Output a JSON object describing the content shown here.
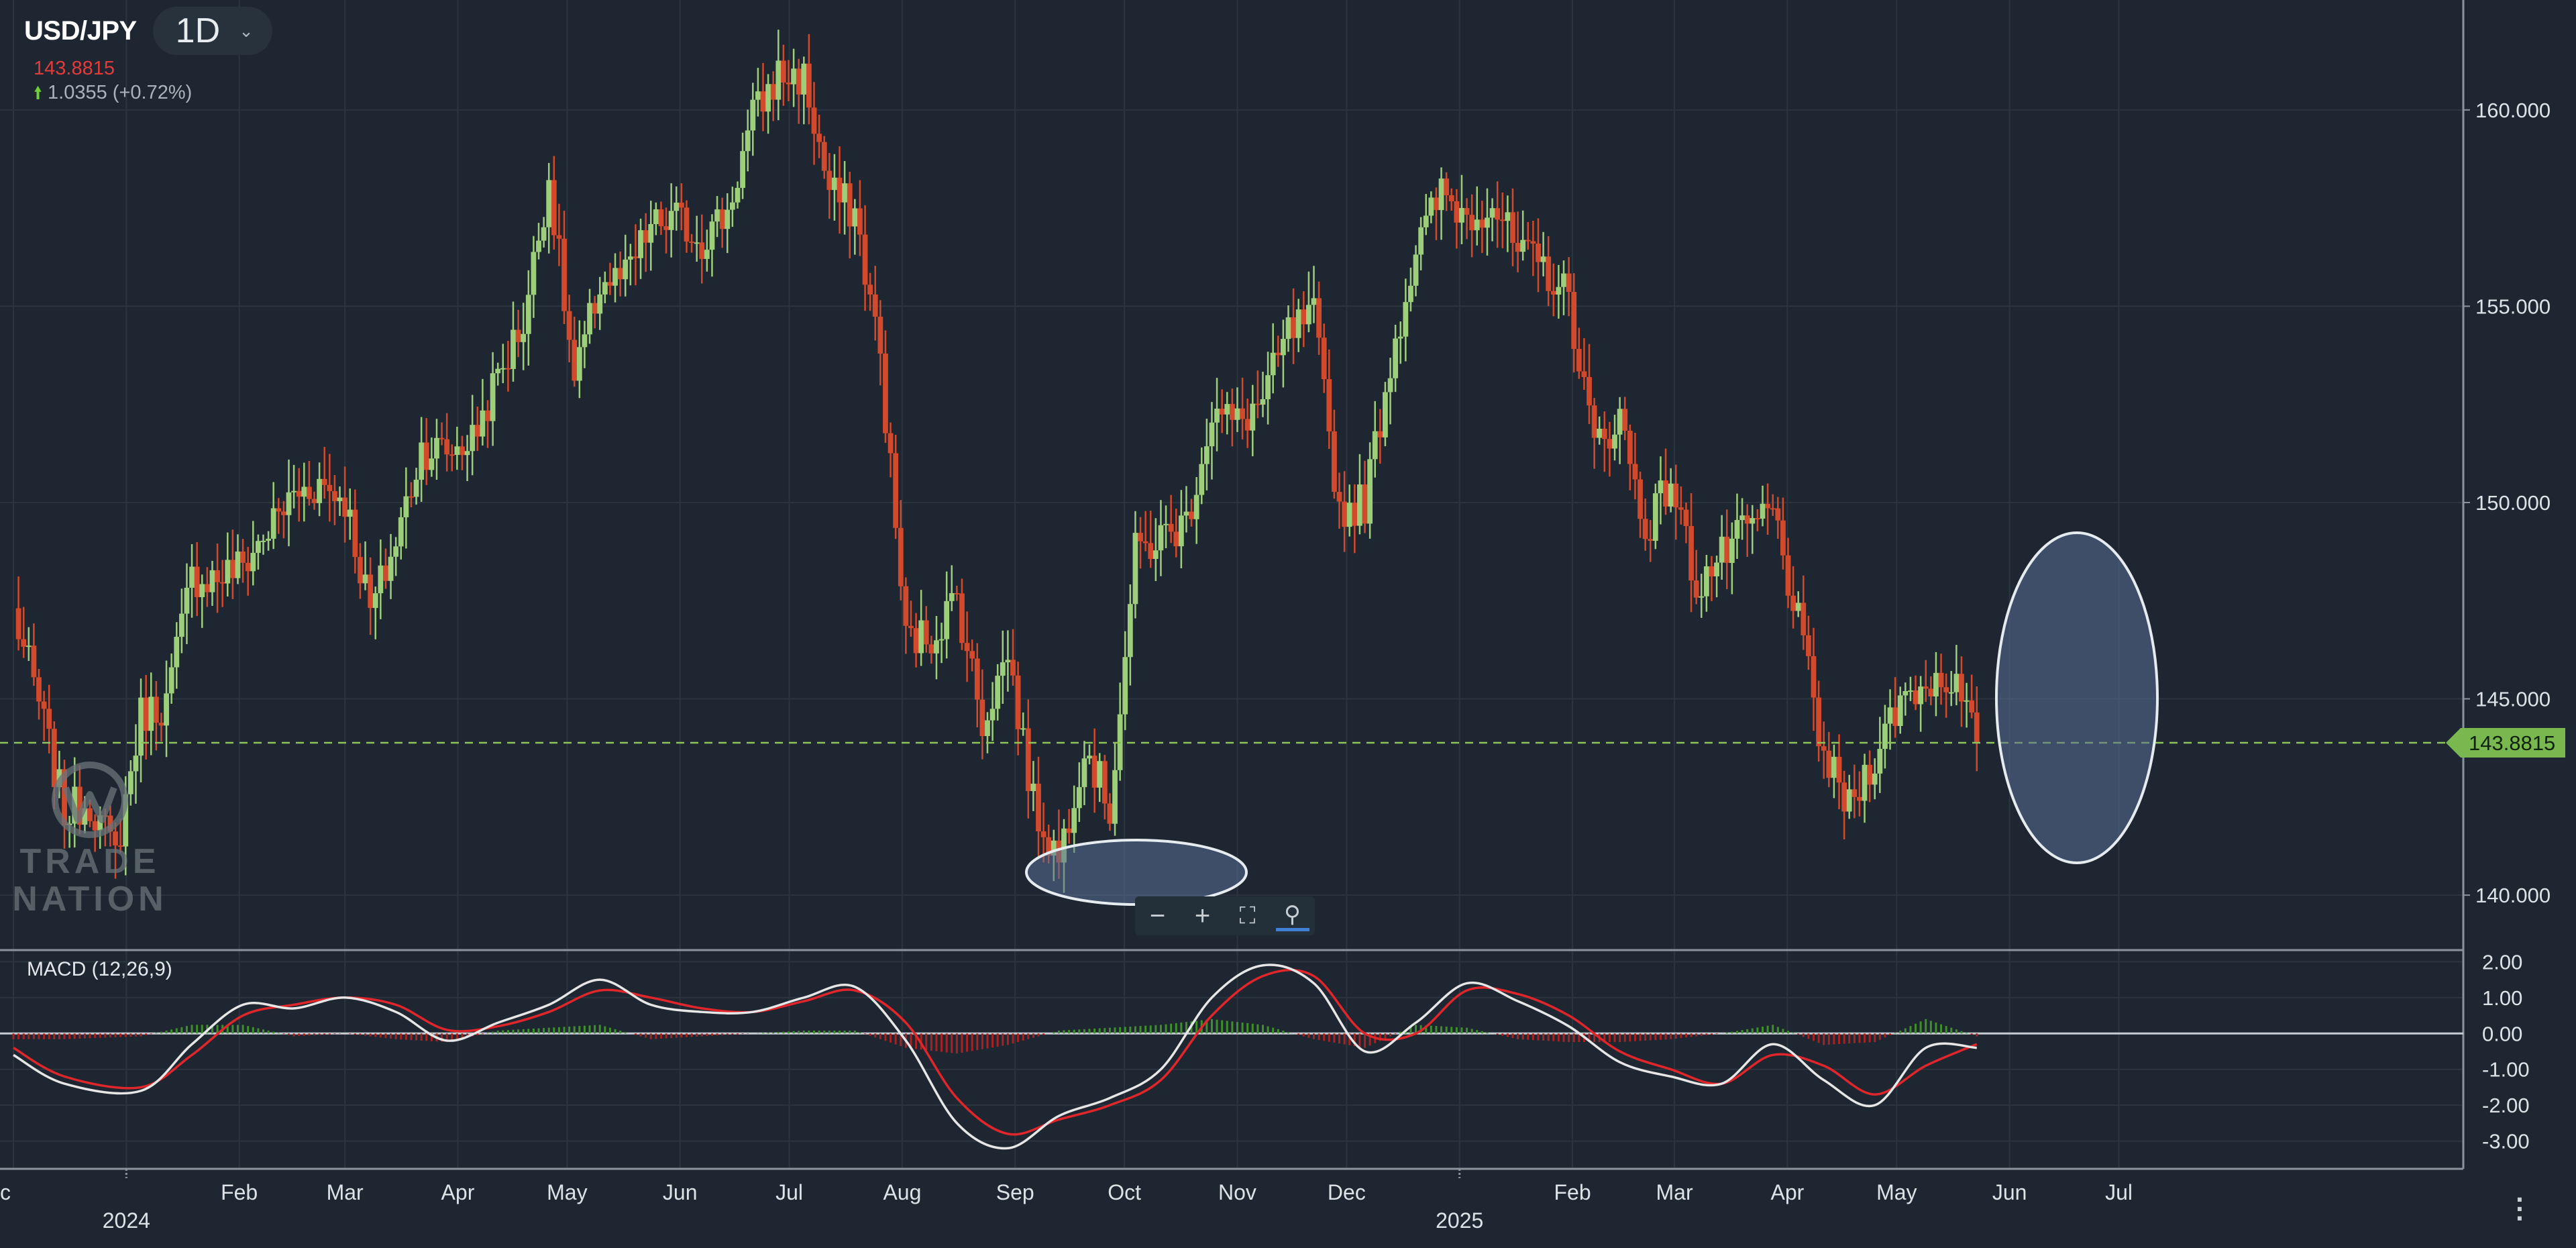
{
  "header": {
    "symbol": "USD/JPY",
    "timeframe": "1D",
    "last_price": "143.8815",
    "change": "1.0355 (+0.72%)"
  },
  "price_tag": "143.8815",
  "macd_label": "MACD (12,26,9)",
  "watermark": {
    "line1": "TRADE",
    "line2": "NATION"
  },
  "colors": {
    "background": "#1e2731",
    "up_candle": "#9dcf7b",
    "down_candle": "#d2492b",
    "macd_line": "#e6e6e6",
    "signal_line": "#e0262a",
    "price_line": "#8fc25a",
    "highlight_ellipse": "#5a6f95"
  },
  "icons": [
    "chevron-down-icon",
    "arrow-up-icon",
    "zoom-out-icon",
    "zoom-in-icon",
    "fullscreen-icon",
    "magnifier-icon",
    "more-vertical-icon"
  ],
  "chart_data": [
    {
      "type": "candlestick",
      "title": "USD/JPY",
      "price_axis": {
        "ticks": [
          140,
          145,
          150,
          155,
          160
        ],
        "tick_labels": [
          "140.000",
          "145.000",
          "150.000",
          "155.000",
          "160.000"
        ],
        "range": [
          138.6,
          162.8
        ]
      },
      "time_axis": {
        "labels": [
          "c",
          "Feb",
          "Mar",
          "Apr",
          "May",
          "Jun",
          "Jul",
          "Aug",
          "Sep",
          "Oct",
          "Nov",
          "Dec",
          "Feb",
          "Mar",
          "Apr",
          "May",
          "Jun",
          "Jul"
        ],
        "year_labels": [
          "2024",
          "2025"
        ]
      },
      "current_price": 143.8815,
      "series": [
        {
          "name": "USD/JPY",
          "points": [
            [
              "2023-12-01",
              147.2
            ],
            [
              "2023-12-08",
              144.9
            ],
            [
              "2023-12-15",
              142.1
            ],
            [
              "2023-12-22",
              142.4
            ],
            [
              "2023-12-29",
              141.0
            ],
            [
              "2024-01-05",
              144.6
            ],
            [
              "2024-01-12",
              144.9
            ],
            [
              "2024-01-19",
              148.1
            ],
            [
              "2024-01-26",
              148.1
            ],
            [
              "2024-02-02",
              148.4
            ],
            [
              "2024-02-09",
              149.3
            ],
            [
              "2024-02-16",
              150.2
            ],
            [
              "2024-02-23",
              150.5
            ],
            [
              "2024-03-01",
              150.1
            ],
            [
              "2024-03-08",
              147.2
            ],
            [
              "2024-03-15",
              149.0
            ],
            [
              "2024-03-22",
              151.4
            ],
            [
              "2024-03-29",
              151.3
            ],
            [
              "2024-04-05",
              151.6
            ],
            [
              "2024-04-12",
              153.2
            ],
            [
              "2024-04-19",
              154.6
            ],
            [
              "2024-04-26",
              158.3
            ],
            [
              "2024-05-03",
              153.0
            ],
            [
              "2024-05-10",
              155.6
            ],
            [
              "2024-05-17",
              155.7
            ],
            [
              "2024-05-24",
              157.0
            ],
            [
              "2024-05-31",
              157.2
            ],
            [
              "2024-06-07",
              156.7
            ],
            [
              "2024-06-14",
              157.4
            ],
            [
              "2024-06-21",
              159.8
            ],
            [
              "2024-06-28",
              160.9
            ],
            [
              "2024-07-05",
              160.8
            ],
            [
              "2024-07-12",
              157.9
            ],
            [
              "2024-07-19",
              157.4
            ],
            [
              "2024-07-26",
              153.7
            ],
            [
              "2024-08-02",
              146.5
            ],
            [
              "2024-08-09",
              146.6
            ],
            [
              "2024-08-16",
              147.6
            ],
            [
              "2024-08-23",
              144.4
            ],
            [
              "2024-08-30",
              146.2
            ],
            [
              "2024-09-06",
              142.3
            ],
            [
              "2024-09-13",
              140.9
            ],
            [
              "2024-09-20",
              143.9
            ],
            [
              "2024-09-27",
              142.2
            ],
            [
              "2024-10-04",
              148.7
            ],
            [
              "2024-10-11",
              149.1
            ],
            [
              "2024-10-18",
              149.5
            ],
            [
              "2024-10-25",
              152.3
            ],
            [
              "2024-11-01",
              152.0
            ],
            [
              "2024-11-08",
              152.6
            ],
            [
              "2024-11-15",
              154.3
            ],
            [
              "2024-11-22",
              154.7
            ],
            [
              "2024-11-29",
              149.8
            ],
            [
              "2024-12-06",
              150.0
            ],
            [
              "2024-12-13",
              153.6
            ],
            [
              "2024-12-20",
              156.4
            ],
            [
              "2024-12-27",
              157.9
            ],
            [
              "2025-01-03",
              157.3
            ],
            [
              "2025-01-10",
              157.7
            ],
            [
              "2025-01-17",
              156.3
            ],
            [
              "2025-01-24",
              156.0
            ],
            [
              "2025-01-31",
              155.2
            ],
            [
              "2025-02-07",
              151.4
            ],
            [
              "2025-02-14",
              152.2
            ],
            [
              "2025-02-21",
              149.3
            ],
            [
              "2025-02-28",
              150.6
            ],
            [
              "2025-03-07",
              147.9
            ],
            [
              "2025-03-14",
              148.6
            ],
            [
              "2025-03-21",
              149.3
            ],
            [
              "2025-03-28",
              149.8
            ],
            [
              "2025-04-04",
              146.9
            ],
            [
              "2025-04-11",
              143.5
            ],
            [
              "2025-04-18",
              142.2
            ],
            [
              "2025-04-25",
              143.6
            ],
            [
              "2025-05-02",
              145.0
            ],
            [
              "2025-05-09",
              145.4
            ],
            [
              "2025-05-16",
              145.6
            ],
            [
              "2025-05-23",
              143.9
            ]
          ]
        }
      ]
    },
    {
      "type": "line",
      "title": "MACD (12,26,9)",
      "y_ticks": [
        2,
        1,
        0,
        -1,
        -2,
        -3
      ],
      "y_tick_labels": [
        "2.00",
        "1.00",
        "0.00",
        "-1.00",
        "-2.00",
        "-3.00"
      ],
      "y_range": [
        -3.7,
        2.25
      ],
      "series": [
        {
          "role": "macd",
          "points": [
            [
              "2023-12-01",
              -0.6
            ],
            [
              "2023-12-15",
              -1.4
            ],
            [
              "2024-01-05",
              -1.6
            ],
            [
              "2024-01-19",
              -0.3
            ],
            [
              "2024-02-02",
              0.8
            ],
            [
              "2024-02-16",
              0.7
            ],
            [
              "2024-03-01",
              1.0
            ],
            [
              "2024-03-15",
              0.6
            ],
            [
              "2024-03-29",
              -0.2
            ],
            [
              "2024-04-12",
              0.3
            ],
            [
              "2024-04-26",
              0.8
            ],
            [
              "2024-05-10",
              1.5
            ],
            [
              "2024-05-24",
              0.8
            ],
            [
              "2024-06-07",
              0.6
            ],
            [
              "2024-06-21",
              0.6
            ],
            [
              "2024-07-05",
              1.0
            ],
            [
              "2024-07-19",
              1.3
            ],
            [
              "2024-08-02",
              -0.2
            ],
            [
              "2024-08-16",
              -2.5
            ],
            [
              "2024-08-30",
              -3.2
            ],
            [
              "2024-09-13",
              -2.3
            ],
            [
              "2024-09-27",
              -1.8
            ],
            [
              "2024-10-11",
              -1.0
            ],
            [
              "2024-10-25",
              1.0
            ],
            [
              "2024-11-08",
              1.9
            ],
            [
              "2024-11-22",
              1.4
            ],
            [
              "2024-12-06",
              -0.5
            ],
            [
              "2024-12-20",
              0.3
            ],
            [
              "2025-01-03",
              1.4
            ],
            [
              "2025-01-17",
              0.9
            ],
            [
              "2025-01-31",
              0.2
            ],
            [
              "2025-02-14",
              -0.8
            ],
            [
              "2025-02-28",
              -1.2
            ],
            [
              "2025-03-14",
              -1.4
            ],
            [
              "2025-03-28",
              -0.3
            ],
            [
              "2025-04-11",
              -1.3
            ],
            [
              "2025-04-25",
              -2.0
            ],
            [
              "2025-05-09",
              -0.4
            ],
            [
              "2025-05-23",
              -0.4
            ]
          ]
        },
        {
          "role": "signal",
          "points": [
            [
              "2023-12-01",
              -0.4
            ],
            [
              "2023-12-15",
              -1.2
            ],
            [
              "2024-01-05",
              -1.5
            ],
            [
              "2024-01-19",
              -0.6
            ],
            [
              "2024-02-02",
              0.5
            ],
            [
              "2024-02-16",
              0.8
            ],
            [
              "2024-03-01",
              1.0
            ],
            [
              "2024-03-15",
              0.8
            ],
            [
              "2024-03-29",
              0.1
            ],
            [
              "2024-04-12",
              0.2
            ],
            [
              "2024-04-26",
              0.6
            ],
            [
              "2024-05-10",
              1.2
            ],
            [
              "2024-05-24",
              1.0
            ],
            [
              "2024-06-07",
              0.7
            ],
            [
              "2024-06-21",
              0.6
            ],
            [
              "2024-07-05",
              0.9
            ],
            [
              "2024-07-19",
              1.2
            ],
            [
              "2024-08-02",
              0.3
            ],
            [
              "2024-08-16",
              -1.8
            ],
            [
              "2024-08-30",
              -2.8
            ],
            [
              "2024-09-13",
              -2.4
            ],
            [
              "2024-09-27",
              -2.0
            ],
            [
              "2024-10-11",
              -1.3
            ],
            [
              "2024-10-25",
              0.5
            ],
            [
              "2024-11-08",
              1.6
            ],
            [
              "2024-11-22",
              1.6
            ],
            [
              "2024-12-06",
              0.0
            ],
            [
              "2024-12-20",
              0.0
            ],
            [
              "2025-01-03",
              1.2
            ],
            [
              "2025-01-17",
              1.1
            ],
            [
              "2025-01-31",
              0.5
            ],
            [
              "2025-02-14",
              -0.5
            ],
            [
              "2025-02-28",
              -1.0
            ],
            [
              "2025-03-14",
              -1.4
            ],
            [
              "2025-03-28",
              -0.6
            ],
            [
              "2025-04-11",
              -0.9
            ],
            [
              "2025-04-25",
              -1.7
            ],
            [
              "2025-05-09",
              -0.9
            ],
            [
              "2025-05-23",
              -0.3
            ]
          ]
        }
      ]
    }
  ]
}
